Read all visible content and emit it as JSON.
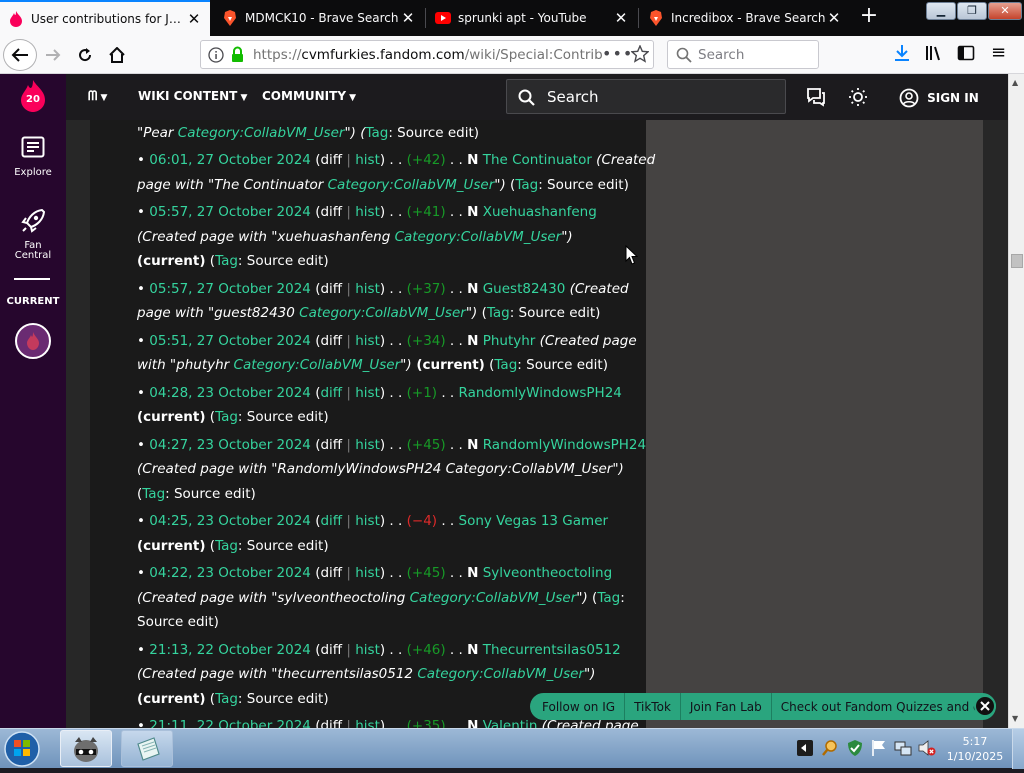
{
  "browser": {
    "tabs": [
      {
        "title": "User contributions for Joncie",
        "icon": "fandom-flame-icon",
        "active": true
      },
      {
        "title": "MDMCK10 - Brave Search",
        "icon": "brave-lion-icon",
        "active": false
      },
      {
        "title": "sprunki apt - YouTube",
        "icon": "youtube-icon",
        "active": false
      },
      {
        "title": "Incredibox - Brave Search",
        "icon": "brave-lion-icon",
        "active": false
      }
    ],
    "url": "https://cvmfurkies.fandom.com/wiki/Special:Contrib",
    "url_prefix": "https://",
    "url_host": "cvmfurkies.fandom.com",
    "url_path": "/wiki/Special:Contrib",
    "search_placeholder": "Search"
  },
  "fandom": {
    "notification_count": "20",
    "rail": {
      "explore": "Explore",
      "fan_central": "Fan Central",
      "current": "CURRENT"
    },
    "nav": {
      "wiki_content": "WIKI CONTENT",
      "community": "COMMUNITY",
      "search": "Search",
      "sign_in": "SIGN IN"
    },
    "contributions": [
      {
        "lines": [
          [
            {
              "t": "\"Pear ",
              "c": "i"
            },
            {
              "t": "Category:CollabVM_User",
              "c": "cat"
            },
            {
              "t": "\") (",
              "c": "i"
            },
            {
              "t": "Tag",
              "c": "g"
            },
            {
              "t": ": Source edit)",
              "c": ""
            }
          ]
        ]
      },
      {
        "lines": [
          [
            {
              "t": "• ",
              "c": ""
            },
            {
              "t": "06:01, 27 October 2024",
              "c": "g"
            },
            {
              "t": " (diff ",
              "c": ""
            },
            {
              "t": "| ",
              "c": "sep"
            },
            {
              "t": "hist",
              "c": "g"
            },
            {
              "t": ") . . ",
              "c": ""
            },
            {
              "t": "(+42)",
              "c": "pos"
            },
            {
              "t": " . . ",
              "c": ""
            },
            {
              "t": "N",
              "c": "b"
            },
            {
              "t": " The Continuator",
              "c": "g"
            },
            {
              "t": " (Created",
              "c": "i"
            }
          ],
          [
            {
              "t": "page with \"The Continuator ",
              "c": "i"
            },
            {
              "t": "Category:CollabVM_User",
              "c": "cat"
            },
            {
              "t": "\")",
              "c": "i"
            },
            {
              "t": " (",
              "c": ""
            },
            {
              "t": "Tag",
              "c": "g"
            },
            {
              "t": ": Source edit)",
              "c": ""
            }
          ]
        ]
      },
      {
        "lines": [
          [
            {
              "t": "• ",
              "c": ""
            },
            {
              "t": "05:57, 27 October 2024",
              "c": "g"
            },
            {
              "t": " (diff ",
              "c": ""
            },
            {
              "t": "| ",
              "c": "sep"
            },
            {
              "t": "hist",
              "c": "g"
            },
            {
              "t": ") . . ",
              "c": ""
            },
            {
              "t": "(+41)",
              "c": "pos"
            },
            {
              "t": " . . ",
              "c": ""
            },
            {
              "t": "N",
              "c": "b"
            },
            {
              "t": " Xuehuashanfeng",
              "c": "g"
            }
          ],
          [
            {
              "t": "(Created page with \"xuehuashanfeng ",
              "c": "i"
            },
            {
              "t": "Category:CollabVM_User",
              "c": "cat"
            },
            {
              "t": "\")",
              "c": "i"
            }
          ],
          [
            {
              "t": "(current)",
              "c": "b"
            },
            {
              "t": " (",
              "c": ""
            },
            {
              "t": "Tag",
              "c": "g"
            },
            {
              "t": ": Source edit)",
              "c": ""
            }
          ]
        ]
      },
      {
        "lines": [
          [
            {
              "t": "• ",
              "c": ""
            },
            {
              "t": "05:57, 27 October 2024",
              "c": "g"
            },
            {
              "t": " (diff ",
              "c": ""
            },
            {
              "t": "| ",
              "c": "sep"
            },
            {
              "t": "hist",
              "c": "g"
            },
            {
              "t": ") . . ",
              "c": ""
            },
            {
              "t": "(+37)",
              "c": "pos"
            },
            {
              "t": " . . ",
              "c": ""
            },
            {
              "t": "N",
              "c": "b"
            },
            {
              "t": " Guest82430",
              "c": "g"
            },
            {
              "t": " (Created",
              "c": "i"
            }
          ],
          [
            {
              "t": "page with \"guest82430 ",
              "c": "i"
            },
            {
              "t": "Category:CollabVM_User",
              "c": "cat"
            },
            {
              "t": "\")",
              "c": "i"
            },
            {
              "t": " (",
              "c": ""
            },
            {
              "t": "Tag",
              "c": "g"
            },
            {
              "t": ": Source edit)",
              "c": ""
            }
          ]
        ]
      },
      {
        "lines": [
          [
            {
              "t": "• ",
              "c": ""
            },
            {
              "t": "05:51, 27 October 2024",
              "c": "g"
            },
            {
              "t": " (diff ",
              "c": ""
            },
            {
              "t": "| ",
              "c": "sep"
            },
            {
              "t": "hist",
              "c": "g"
            },
            {
              "t": ") . . ",
              "c": ""
            },
            {
              "t": "(+34)",
              "c": "pos"
            },
            {
              "t": " . . ",
              "c": ""
            },
            {
              "t": "N",
              "c": "b"
            },
            {
              "t": " Phutyhr",
              "c": "g"
            },
            {
              "t": " (Created page",
              "c": "i"
            }
          ],
          [
            {
              "t": "with \"phutyhr ",
              "c": "i"
            },
            {
              "t": "Category:CollabVM_User",
              "c": "cat"
            },
            {
              "t": "\")",
              "c": "i"
            },
            {
              "t": " (current)",
              "c": "b"
            },
            {
              "t": " (",
              "c": ""
            },
            {
              "t": "Tag",
              "c": "g"
            },
            {
              "t": ": Source edit)",
              "c": ""
            }
          ]
        ]
      },
      {
        "lines": [
          [
            {
              "t": "• ",
              "c": ""
            },
            {
              "t": "04:28, 23 October 2024",
              "c": "g"
            },
            {
              "t": " (",
              "c": ""
            },
            {
              "t": "diff",
              "c": "g"
            },
            {
              "t": " | ",
              "c": "sep"
            },
            {
              "t": "hist",
              "c": "g"
            },
            {
              "t": ") . . ",
              "c": ""
            },
            {
              "t": "(+1)",
              "c": "pos"
            },
            {
              "t": " . . ",
              "c": ""
            },
            {
              "t": "RandomlyWindowsPH24",
              "c": "g"
            }
          ],
          [
            {
              "t": "(current)",
              "c": "b"
            },
            {
              "t": " (",
              "c": ""
            },
            {
              "t": "Tag",
              "c": "g"
            },
            {
              "t": ": Source edit)",
              "c": ""
            }
          ]
        ]
      },
      {
        "lines": [
          [
            {
              "t": "• ",
              "c": ""
            },
            {
              "t": "04:27, 23 October 2024",
              "c": "g"
            },
            {
              "t": " (diff ",
              "c": ""
            },
            {
              "t": "| ",
              "c": "sep"
            },
            {
              "t": "hist",
              "c": "g"
            },
            {
              "t": ") . . ",
              "c": ""
            },
            {
              "t": "(+45)",
              "c": "pos"
            },
            {
              "t": " . . ",
              "c": ""
            },
            {
              "t": "N",
              "c": "b"
            },
            {
              "t": " RandomlyWindowsPH24",
              "c": "g"
            }
          ],
          [
            {
              "t": "(Created page with \"RandomlyWindowsPH24 Category:CollabVM_User\")",
              "c": "i"
            }
          ],
          [
            {
              "t": "(",
              "c": ""
            },
            {
              "t": "Tag",
              "c": "g"
            },
            {
              "t": ": Source edit)",
              "c": ""
            }
          ]
        ]
      },
      {
        "lines": [
          [
            {
              "t": "• ",
              "c": ""
            },
            {
              "t": "04:25, 23 October 2024",
              "c": "g"
            },
            {
              "t": " (",
              "c": ""
            },
            {
              "t": "diff",
              "c": "g"
            },
            {
              "t": " | ",
              "c": "sep"
            },
            {
              "t": "hist",
              "c": "g"
            },
            {
              "t": ") . . ",
              "c": ""
            },
            {
              "t": "(−4)",
              "c": "neg"
            },
            {
              "t": " . . ",
              "c": ""
            },
            {
              "t": "Sony Vegas 13 Gamer",
              "c": "g"
            }
          ],
          [
            {
              "t": "(current)",
              "c": "b"
            },
            {
              "t": " (",
              "c": ""
            },
            {
              "t": "Tag",
              "c": "g"
            },
            {
              "t": ": Source edit)",
              "c": ""
            }
          ]
        ]
      },
      {
        "lines": [
          [
            {
              "t": "• ",
              "c": ""
            },
            {
              "t": "04:22, 23 October 2024",
              "c": "g"
            },
            {
              "t": " (diff ",
              "c": ""
            },
            {
              "t": "| ",
              "c": "sep"
            },
            {
              "t": "hist",
              "c": "g"
            },
            {
              "t": ") . . ",
              "c": ""
            },
            {
              "t": "(+45)",
              "c": "pos"
            },
            {
              "t": " . . ",
              "c": ""
            },
            {
              "t": "N",
              "c": "b"
            },
            {
              "t": " Sylveontheoctoling",
              "c": "g"
            }
          ],
          [
            {
              "t": "(Created page with \"sylveontheoctoling ",
              "c": "i"
            },
            {
              "t": "Category:CollabVM_User",
              "c": "cat"
            },
            {
              "t": "\")",
              "c": "i"
            },
            {
              "t": " (",
              "c": ""
            },
            {
              "t": "Tag",
              "c": "g"
            },
            {
              "t": ":",
              "c": ""
            }
          ],
          [
            {
              "t": "Source edit)",
              "c": ""
            }
          ]
        ]
      },
      {
        "lines": [
          [
            {
              "t": "• ",
              "c": ""
            },
            {
              "t": "21:13, 22 October 2024",
              "c": "g"
            },
            {
              "t": " (diff ",
              "c": ""
            },
            {
              "t": "| ",
              "c": "sep"
            },
            {
              "t": "hist",
              "c": "g"
            },
            {
              "t": ") . . ",
              "c": ""
            },
            {
              "t": "(+46)",
              "c": "pos"
            },
            {
              "t": " . . ",
              "c": ""
            },
            {
              "t": "N",
              "c": "b"
            },
            {
              "t": " Thecurrentsilas0512",
              "c": "g"
            }
          ],
          [
            {
              "t": "(Created page with \"thecurrentsilas0512 ",
              "c": "i"
            },
            {
              "t": "Category:CollabVM_User",
              "c": "cat"
            },
            {
              "t": "\")",
              "c": "i"
            }
          ],
          [
            {
              "t": "(current)",
              "c": "b"
            },
            {
              "t": " (",
              "c": ""
            },
            {
              "t": "Tag",
              "c": "g"
            },
            {
              "t": ": Source edit)",
              "c": ""
            }
          ]
        ]
      },
      {
        "lines": [
          [
            {
              "t": "• ",
              "c": ""
            },
            {
              "t": "21:11, 22 October 2024",
              "c": "g"
            },
            {
              "t": " (diff ",
              "c": ""
            },
            {
              "t": "| ",
              "c": "sep"
            },
            {
              "t": "hist",
              "c": "g"
            },
            {
              "t": ") . . ",
              "c": ""
            },
            {
              "t": "(+35)",
              "c": "pos"
            },
            {
              "t": " . . ",
              "c": ""
            },
            {
              "t": "N",
              "c": "b"
            },
            {
              "t": " Valentin",
              "c": "g"
            },
            {
              "t": " (Created page",
              "c": "i"
            }
          ]
        ]
      }
    ],
    "bottom_bar": {
      "ig": "Follow on IG",
      "tiktok": "TikTok",
      "fanlab": "Join Fan Lab",
      "quizzes": "Check out Fandom Quizzes and cha"
    }
  },
  "taskbar": {
    "time": "5:17",
    "date": "1/10/2025"
  },
  "colors": {
    "link_green": "#35d49e",
    "positive": "#179a27",
    "negative": "#dd2a2a",
    "rail": "#26062d",
    "fandom_pink": "#fa005a",
    "accent_blue": "#0a84ff"
  }
}
